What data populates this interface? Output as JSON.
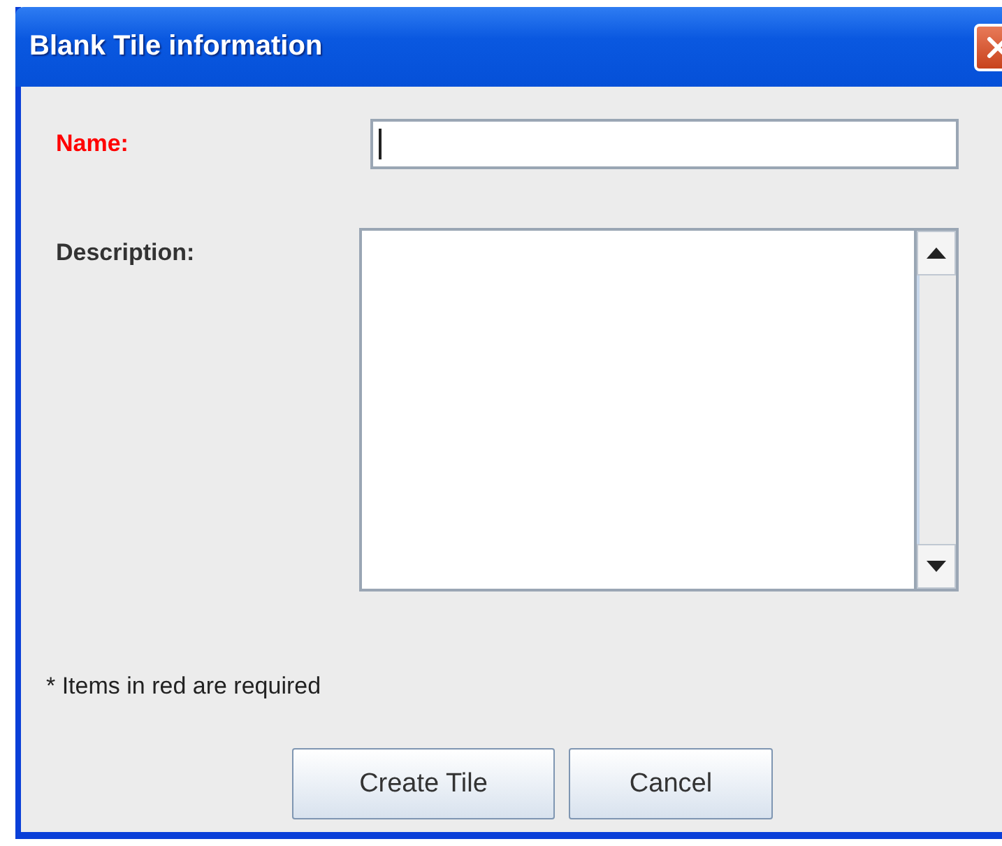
{
  "window": {
    "title": "Blank Tile information"
  },
  "fields": [
    {
      "label": "Name:",
      "required": true,
      "kind": "line"
    },
    {
      "label": "Description:",
      "required": false,
      "kind": "area"
    }
  ],
  "note": "* Items in red are required",
  "buttons": [
    "Create Tile",
    "Cancel"
  ]
}
